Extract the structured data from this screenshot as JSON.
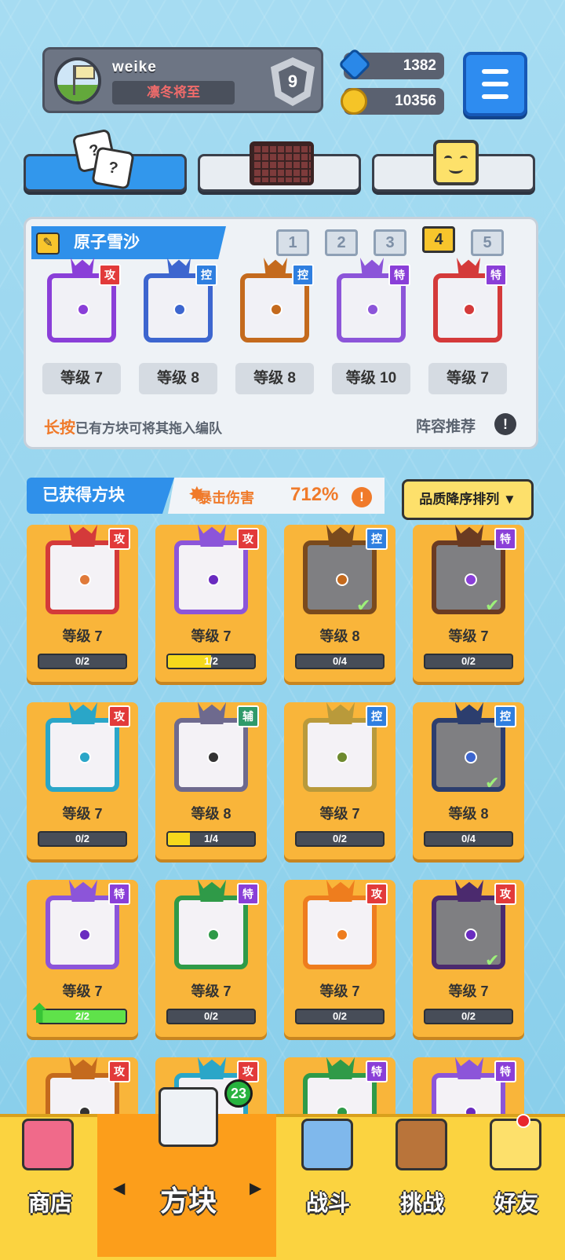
{
  "profile": {
    "username": "weike",
    "title": "凛冬将至",
    "rank": "9"
  },
  "currency": {
    "gems": "1382",
    "coins": "10356"
  },
  "top_tabs": [
    {
      "icon": "dice-icon",
      "active": true
    },
    {
      "icon": "board-icon",
      "active": false
    },
    {
      "icon": "smiley-block-icon",
      "active": false
    }
  ],
  "deck": {
    "name": "原子雪沙",
    "tabs": [
      "1",
      "2",
      "3",
      "4",
      "5"
    ],
    "active_tab": "4",
    "slots": [
      {
        "type": "攻",
        "level": "等级 7",
        "color": "#8a3fd8"
      },
      {
        "type": "控",
        "level": "等级 8",
        "color": "#3d66cf"
      },
      {
        "type": "控",
        "level": "等级 8",
        "color": "#c46a1d"
      },
      {
        "type": "特",
        "level": "等级 10",
        "color": "#8c55d9"
      },
      {
        "type": "特",
        "level": "等级 7",
        "color": "#d43a3a"
      }
    ],
    "hint_highlight": "长按",
    "hint_rest": "已有方块可将其拖入编队",
    "recommend": "阵容推荐",
    "recommend_icon": "!"
  },
  "owned": {
    "title": "已获得方块",
    "crit_label": "暴击伤害",
    "crit_value": "712%",
    "crit_icon": "!",
    "sort_label": "品质降序排列 ▼"
  },
  "cards": [
    {
      "type": "攻",
      "level": "等级 7",
      "progress": "0/2",
      "fill": 0,
      "color": "#d43a3a",
      "dot": "#e07a3a",
      "dim": false,
      "check": false
    },
    {
      "type": "攻",
      "level": "等级 7",
      "progress": "1/2",
      "fill": 0.5,
      "color": "#8c55d9",
      "dot": "#6a2bc0",
      "dim": false,
      "check": false
    },
    {
      "type": "控",
      "level": "等级 8",
      "progress": "0/4",
      "fill": 0,
      "color": "#7a4a1d",
      "dot": "#c46a1d",
      "dim": true,
      "check": true
    },
    {
      "type": "特",
      "level": "等级 7",
      "progress": "0/2",
      "fill": 0,
      "color": "#6b3b22",
      "dot": "#8a3fd8",
      "dim": true,
      "check": true
    },
    {
      "type": "攻",
      "level": "等级 7",
      "progress": "0/2",
      "fill": 0,
      "color": "#2aa6c8",
      "dot": "#2aa6c8",
      "dim": false,
      "check": false
    },
    {
      "type": "辅",
      "level": "等级 8",
      "progress": "1/4",
      "fill": 0.25,
      "color": "#6e6a8e",
      "dot": "#333333",
      "dim": false,
      "check": false
    },
    {
      "type": "控",
      "level": "等级 7",
      "progress": "0/2",
      "fill": 0,
      "color": "#b99a3b",
      "dot": "#6e8a2e",
      "dim": false,
      "check": false
    },
    {
      "type": "控",
      "level": "等级 8",
      "progress": "0/4",
      "fill": 0,
      "color": "#2c3e6e",
      "dot": "#3d66cf",
      "dim": true,
      "check": true
    },
    {
      "type": "特",
      "level": "等级 7",
      "progress": "2/2",
      "fill": 1,
      "color": "#8c55d9",
      "dot": "#6a2bc0",
      "dim": false,
      "check": false,
      "upgrade": true
    },
    {
      "type": "特",
      "level": "等级 7",
      "progress": "0/2",
      "fill": 0,
      "color": "#2f9a48",
      "dot": "#2f9a48",
      "dim": false,
      "check": false
    },
    {
      "type": "攻",
      "level": "等级 7",
      "progress": "0/2",
      "fill": 0,
      "color": "#ee7d1e",
      "dot": "#ee7d1e",
      "dim": false,
      "check": false
    },
    {
      "type": "攻",
      "level": "等级 7",
      "progress": "0/2",
      "fill": 0,
      "color": "#4b2a6e",
      "dot": "#6a2bc0",
      "dim": true,
      "check": true
    },
    {
      "type": "攻",
      "level": "",
      "progress": "",
      "fill": 0,
      "color": "#c46a1d",
      "dot": "#333333",
      "dim": false,
      "check": false
    },
    {
      "type": "攻",
      "level": "",
      "progress": "",
      "fill": 0,
      "color": "#2aa6c8",
      "dot": "#2aa6c8",
      "dim": false,
      "check": false
    },
    {
      "type": "特",
      "level": "",
      "progress": "",
      "fill": 0,
      "color": "#2f9a48",
      "dot": "#2f9a48",
      "dim": false,
      "check": false
    },
    {
      "type": "特",
      "level": "",
      "progress": "",
      "fill": 0,
      "color": "#8c55d9",
      "dot": "#6a2bc0",
      "dim": false,
      "check": false
    }
  ],
  "nav": {
    "shop": "商店",
    "blocks": "方块",
    "battle": "战斗",
    "challenge": "挑战",
    "friends": "好友",
    "blocks_badge": "23",
    "arrow_left": "◀",
    "arrow_right": "▶"
  },
  "colors": {
    "type_atk": "#e23a3a",
    "type_ctrl": "#2f7fe0",
    "type_special": "#8a3fd8",
    "type_support": "#2f9a6a",
    "bar_yellow": "#f5d91c",
    "bar_green": "#5fe24a"
  }
}
